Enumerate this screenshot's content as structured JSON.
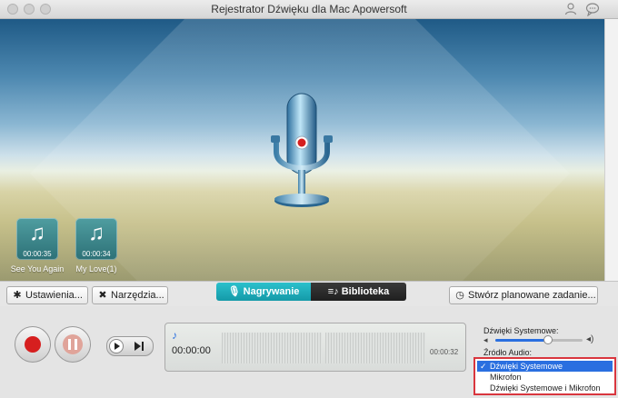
{
  "window": {
    "title": "Rejestrator Dźwięku dla Mac Apowersoft"
  },
  "recordings": [
    {
      "name": "See You Again",
      "duration": "00:00:35"
    },
    {
      "name": "My Love(1)",
      "duration": "00:00:34"
    }
  ],
  "toolbar": {
    "settings_label": "Ustawienia...",
    "tools_label": "Narzędzia...",
    "tab_recording": "Nagrywanie",
    "tab_library": "Biblioteka",
    "schedule_label": "Stwórz planowane zadanie..."
  },
  "player": {
    "current_time": "00:00:00",
    "total_time": "00:00:32",
    "volume_label": "Dźwięki Systemowe:",
    "volume_level": 0.6,
    "source_label": "Źródło Audio:"
  },
  "audio_sources": {
    "selected": "Dźwięki Systemowe",
    "options": [
      "Dźwięki Systemowe",
      "Mikrofon",
      "Dźwięki Systemowe i Mikrofon"
    ]
  },
  "colors": {
    "accent": "#2a6fe0",
    "record_red": "#d61f1f",
    "tab_active": "#1aa6b4",
    "tab_inactive": "#2b2b2b",
    "highlight_border": "#d9363e"
  }
}
